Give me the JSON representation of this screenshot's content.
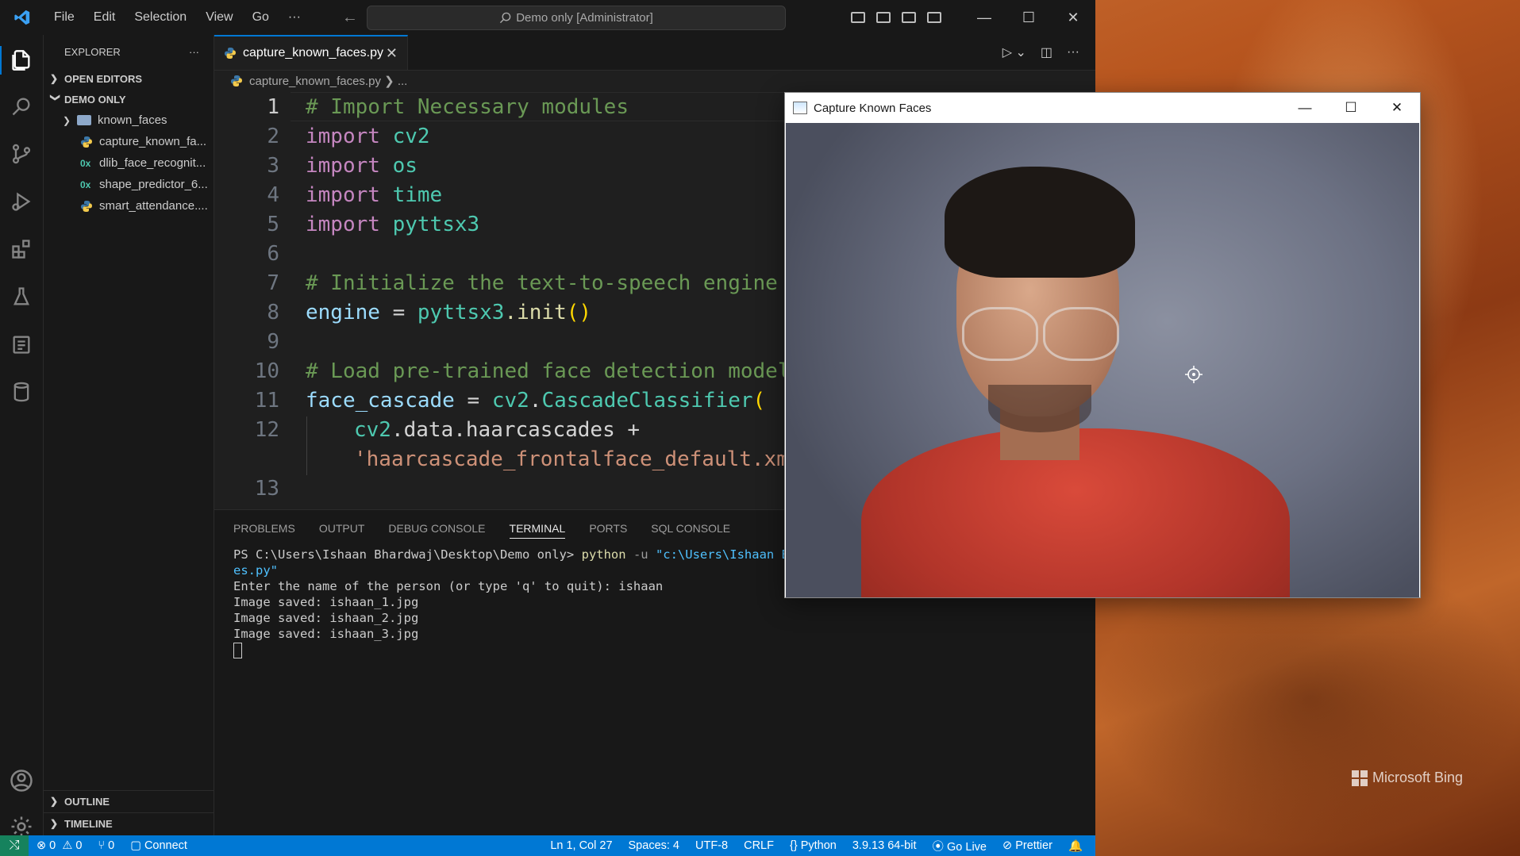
{
  "titlebar": {
    "menu": [
      "File",
      "Edit",
      "Selection",
      "View",
      "Go",
      "···"
    ],
    "search": "Demo only [Administrator]"
  },
  "explorer": {
    "title": "EXPLORER",
    "more": "···",
    "open_editors": "OPEN EDITORS",
    "workspace": "DEMO ONLY",
    "items": [
      {
        "name": "known_faces",
        "icon": "folder-icon"
      },
      {
        "name": "capture_known_fa...",
        "icon": "python-file-icon"
      },
      {
        "name": "dlib_face_recognit...",
        "icon": "binary-file-icon"
      },
      {
        "name": "shape_predictor_6...",
        "icon": "binary-file-icon"
      },
      {
        "name": "smart_attendance....",
        "icon": "python-file-icon"
      }
    ],
    "outline": "OUTLINE",
    "timeline": "TIMELINE",
    "binary_glyph": "0x"
  },
  "editor": {
    "tab_label": "capture_known_faces.py",
    "breadcrumb_file": "capture_known_faces.py",
    "breadcrumb_rest": "...",
    "lines": [
      {
        "n": "1"
      },
      {
        "n": "2"
      },
      {
        "n": "3"
      },
      {
        "n": "4"
      },
      {
        "n": "5"
      },
      {
        "n": "6"
      },
      {
        "n": "7"
      },
      {
        "n": "8"
      },
      {
        "n": "9"
      },
      {
        "n": "10"
      },
      {
        "n": "11"
      },
      {
        "n": "12"
      },
      {
        "n": ""
      },
      {
        "n": "13"
      }
    ],
    "code": {
      "l1": "# Import Necessary modules",
      "import": "import",
      "l2_mod": "cv2",
      "l3_mod": "os",
      "l4_mod": "time",
      "l5_mod": "pyttsx3",
      "l7": "# Initialize the text-to-speech engine",
      "l8_var": "engine",
      "l8_op": " = ",
      "l8_mod": "pyttsx3",
      "l8_fn": ".init",
      "l8_paren": "()",
      "l10": "# Load pre-trained face detection model",
      "l11_var": "face_cascade",
      "l11_op": " = ",
      "l11_mod": "cv2",
      "l11_dot": ".",
      "l11_fn": "CascadeClassifier",
      "l11_paren": "(",
      "l12a_mod": "cv2",
      "l12a_rest": ".data.haarcascades +",
      "l12b_str": "'haarcascade_frontalface_default.xml'"
    }
  },
  "panel": {
    "tabs": [
      "PROBLEMS",
      "OUTPUT",
      "DEBUG CONSOLE",
      "TERMINAL",
      "PORTS",
      "SQL CONSOLE"
    ],
    "active_tab": "TERMINAL",
    "terminal": {
      "prompt": "PS C:\\Users\\Ishaan Bhardwaj\\Desktop\\Demo only> ",
      "cmd": "python",
      "flag": " -u ",
      "path": "\"c:\\Users\\Ishaan Bhardwaj\\Desktop\\Demo only\\capture_known_fac",
      "path_end": "es.py\"",
      "out1": "Enter the name of the person (or type 'q' to quit): ishaan",
      "out2": "Image saved: ishaan_1.jpg",
      "out3": "Image saved: ishaan_2.jpg",
      "out4": "Image saved: ishaan_3.jpg"
    }
  },
  "statusbar": {
    "remote": "⤭",
    "errors": "⊗ 0",
    "warnings": "⚠ 0",
    "ports": "⑂ 0",
    "connect": "Connect",
    "position": "Ln 1, Col 27",
    "spaces": "Spaces: 4",
    "encoding": "UTF-8",
    "eol": "CRLF",
    "language": "Python",
    "interpreter": "3.9.13 64-bit",
    "golive": "Go Live",
    "prettier": "Prettier",
    "bell": "🔔"
  },
  "capture_window": {
    "title": "Capture Known Faces",
    "min": "—",
    "max": "☐",
    "close": "✕"
  },
  "desktop": {
    "watermark": "Microsoft Bing"
  },
  "colors": {
    "accent": "#0078d4",
    "statusbar": "#0078d4",
    "remote": "#16825d"
  }
}
